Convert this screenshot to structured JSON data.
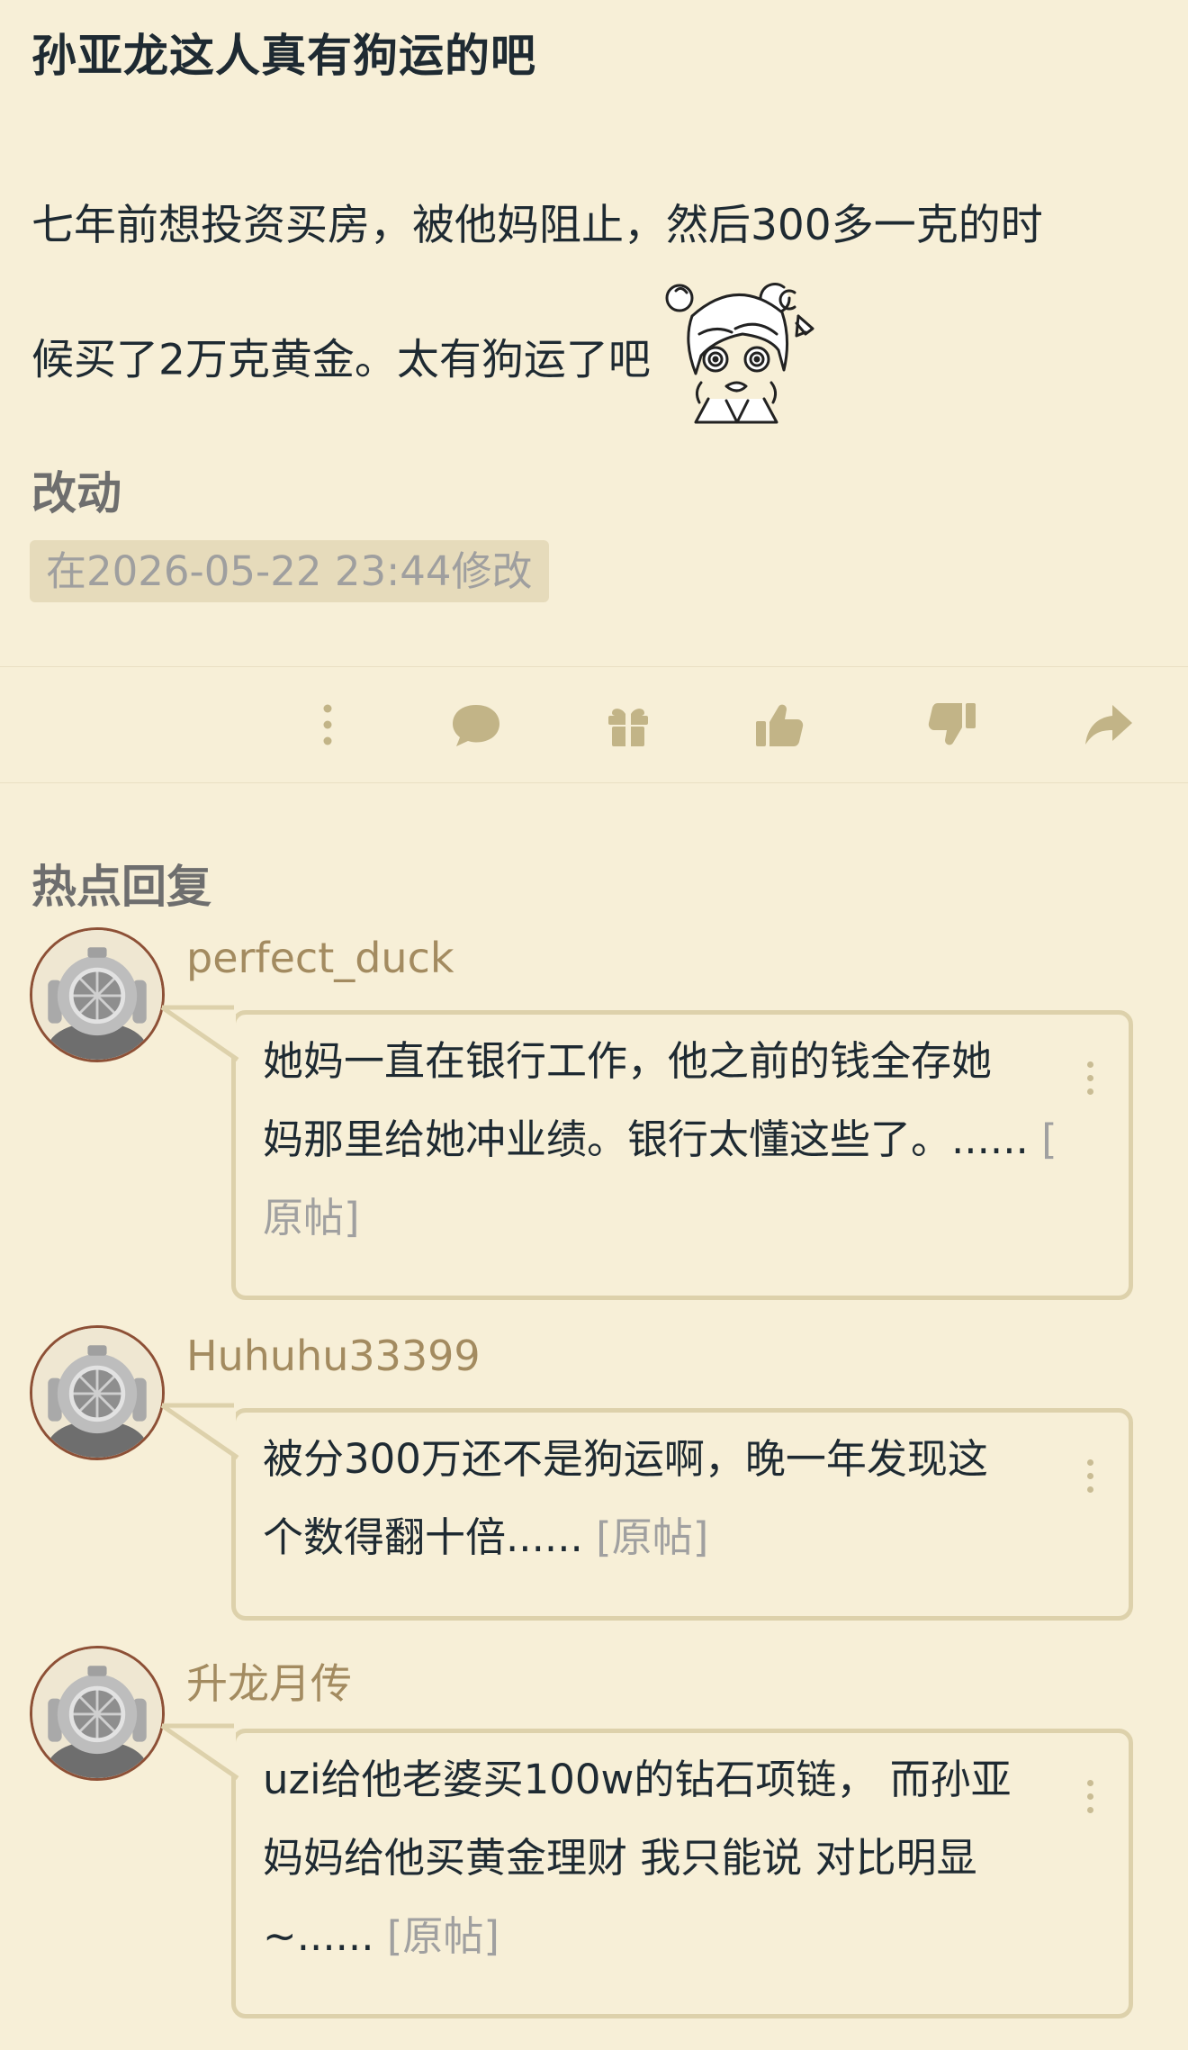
{
  "post": {
    "title": "孙亚龙这人真有狗运的吧",
    "body_line1": "七年前想投资买房，被他妈阻止，然后300多一克的时",
    "body_line2": "候买了2万克黄金。太有狗运了吧",
    "edit_heading": "改动",
    "edit_note": "在2026-05-22 23:44修改"
  },
  "actions": {
    "icons": [
      "more-vertical-icon",
      "comment-icon",
      "gift-icon",
      "thumbs-up-icon",
      "thumbs-down-icon",
      "share-arrow-icon"
    ]
  },
  "hot_replies": {
    "heading": "热点回复",
    "items": [
      {
        "username": "perfect_duck",
        "line1": "她妈一直在银行工作，他之前的钱全存她",
        "line2": "妈那里给她冲业绩。银行太懂这些了。......",
        "line2_link": " [",
        "line3_link": "原帖]"
      },
      {
        "username": "Huhuhu33399",
        "line1": "被分300万还不是狗运啊，晚一年发现这",
        "line2": "个数得翻十倍......",
        "line2_link": " [原帖]"
      },
      {
        "username": "升龙月传",
        "line1": "uzi给他老婆买100w的钻石项链，  而孙亚",
        "line2": "妈妈给他买黄金理财 我只能说 对比明显",
        "line3": "~......",
        "line3_link": " [原帖]"
      }
    ]
  },
  "colors": {
    "background": "#f7efd7",
    "username": "#a38b60",
    "bubble_border": "#ddd1ab",
    "avatar_border": "#8d5036",
    "muted_text": "#a0a0a0"
  }
}
